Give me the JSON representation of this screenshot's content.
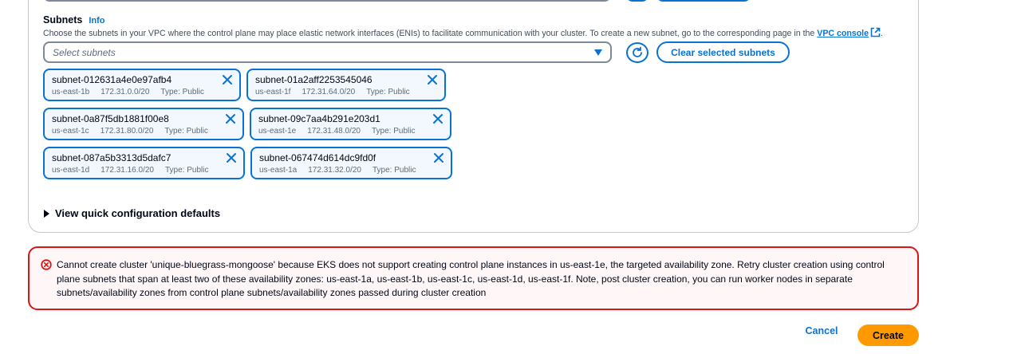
{
  "subnets_field": {
    "label": "Subnets",
    "info": "Info",
    "description": "Choose the subnets in your VPC where the control plane may place elastic network interfaces (ENIs) to facilitate communication with your cluster. To create a new subnet, go to the corresponding page in the",
    "console_link": "VPC console",
    "description_end": ".",
    "select_placeholder": "Select subnets",
    "clear_button": "Clear selected subnets"
  },
  "tokens": [
    {
      "name": "subnet-012631a4e0e97afb4",
      "az": "us-east-1b",
      "cidr": "172.31.0.0/20",
      "type": "Type: Public"
    },
    {
      "name": "subnet-01a2aff2253545046",
      "az": "us-east-1f",
      "cidr": "172.31.64.0/20",
      "type": "Type: Public"
    },
    {
      "name": "subnet-0a87f5db1881f00e8",
      "az": "us-east-1c",
      "cidr": "172.31.80.0/20",
      "type": "Type: Public"
    },
    {
      "name": "subnet-09c7aa4b291e203d1",
      "az": "us-east-1e",
      "cidr": "172.31.48.0/20",
      "type": "Type: Public"
    },
    {
      "name": "subnet-087a5b3313d5dafc7",
      "az": "us-east-1d",
      "cidr": "172.31.16.0/20",
      "type": "Type: Public"
    },
    {
      "name": "subnet-067474d614dc9fd0f",
      "az": "us-east-1a",
      "cidr": "172.31.32.0/20",
      "type": "Type: Public"
    }
  ],
  "quick_config": "View quick configuration defaults",
  "error": {
    "message": "Cannot create cluster 'unique-bluegrass-mongoose' because EKS does not support creating control plane instances in us-east-1e, the targeted availability zone. Retry cluster creation using control plane subnets that span at least two of these availability zones: us-east-1a, us-east-1b, us-east-1c, us-east-1d, us-east-1f. Note, post cluster creation, you can run worker nodes in separate subnets/availability zones from control plane subnets/availability zones passed during cluster creation"
  },
  "footer": {
    "cancel": "Cancel",
    "create": "Create"
  },
  "colors": {
    "accent": "#0972d3",
    "error": "#d91515",
    "primary_button": "#ff9900"
  },
  "icons": {
    "refresh": "refresh-icon",
    "dismiss": "close-icon",
    "external": "external-link-icon",
    "error": "error-status-icon",
    "dropdown": "caret-down-icon",
    "expand": "caret-right-icon"
  }
}
